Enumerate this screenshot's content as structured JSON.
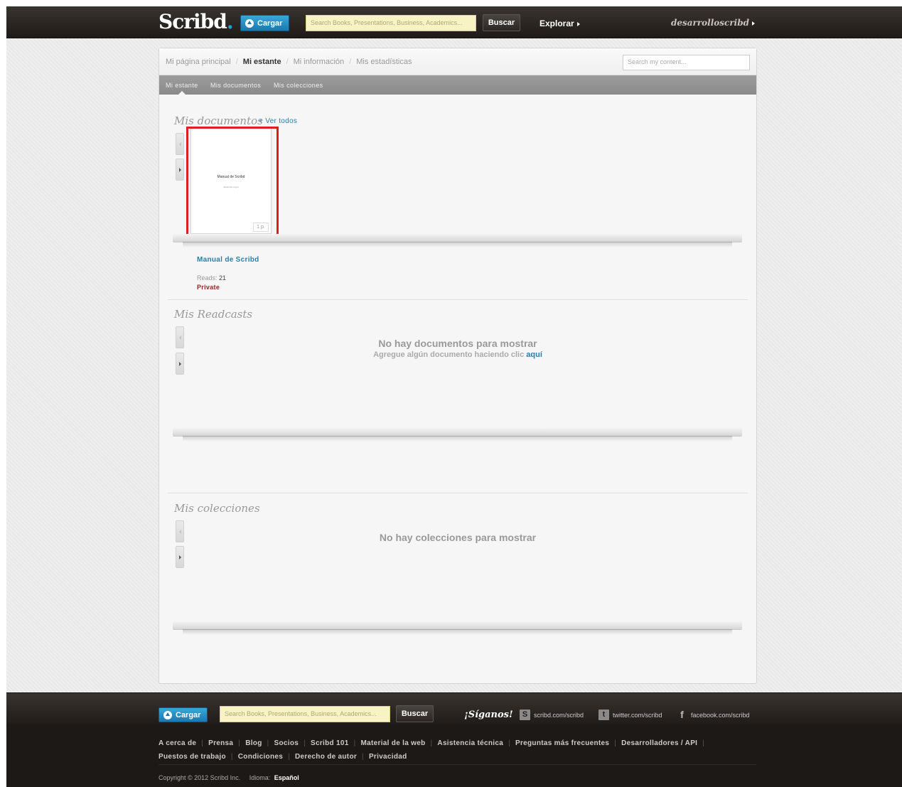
{
  "header": {
    "logo_text": "Scribd",
    "upload_label": "Cargar",
    "search_placeholder": "Search Books, Presentations, Business, Academics...",
    "search_button": "Buscar",
    "explore_label": "Explorar",
    "username": "desarrolloscribd"
  },
  "tabs": [
    {
      "label": "Mi página principal",
      "active": false
    },
    {
      "label": "Mi estante",
      "active": true
    },
    {
      "label": "Mi información",
      "active": false
    },
    {
      "label": "Mis estadísticas",
      "active": false
    }
  ],
  "search_mine_placeholder": "Search my content...",
  "subtabs": [
    "Mi estante",
    "Mis documentos",
    "Mis colecciones"
  ],
  "documents": {
    "title": "Mis documentos",
    "view_all": "+ Ver todos",
    "items": [
      {
        "title": "Manual de Scribd",
        "thumb_title": "Manual de Scribd",
        "thumb_subtitle": "desarrollo.org.ar",
        "pages": "1 p.",
        "reads_label": "Reads:",
        "reads": "21",
        "status": "Private"
      }
    ]
  },
  "readcasts": {
    "title": "Mis Readcasts",
    "empty_message": "No hay documentos para mostrar",
    "empty_sub": "Agregue algún documento haciendo clic",
    "empty_link": "aquí"
  },
  "collections": {
    "title": "Mis colecciones",
    "empty_message": "No hay colecciones para mostrar"
  },
  "footer": {
    "upload_label": "Cargar",
    "search_placeholder": "Search Books, Presentations, Business, Academics...",
    "search_button": "Buscar",
    "follow_label": "¡Síganos!",
    "social": [
      {
        "icon": "scribd-icon",
        "label": "scribd.com/scribd"
      },
      {
        "icon": "twitter-icon",
        "label": "twitter.com/scribd"
      },
      {
        "icon": "facebook-icon",
        "label": "facebook.com/scribd"
      }
    ],
    "links_row1": [
      "A cerca de",
      "Prensa",
      "Blog",
      "Socios",
      "Scribd 101",
      "Material de la web",
      "Asistencia técnica",
      "Preguntas más frecuentes",
      "Desarrolladores / API"
    ],
    "links_row2": [
      "Puestos de trabajo",
      "Condiciones",
      "Derecho de autor",
      "Privacidad"
    ],
    "copyright": "Copyright © 2012 Scribd Inc.",
    "language_label": "Idioma:",
    "language": "Español"
  },
  "colors": {
    "accent": "#2a7ea8",
    "highlight": "#e31b23",
    "private": "#992222"
  }
}
